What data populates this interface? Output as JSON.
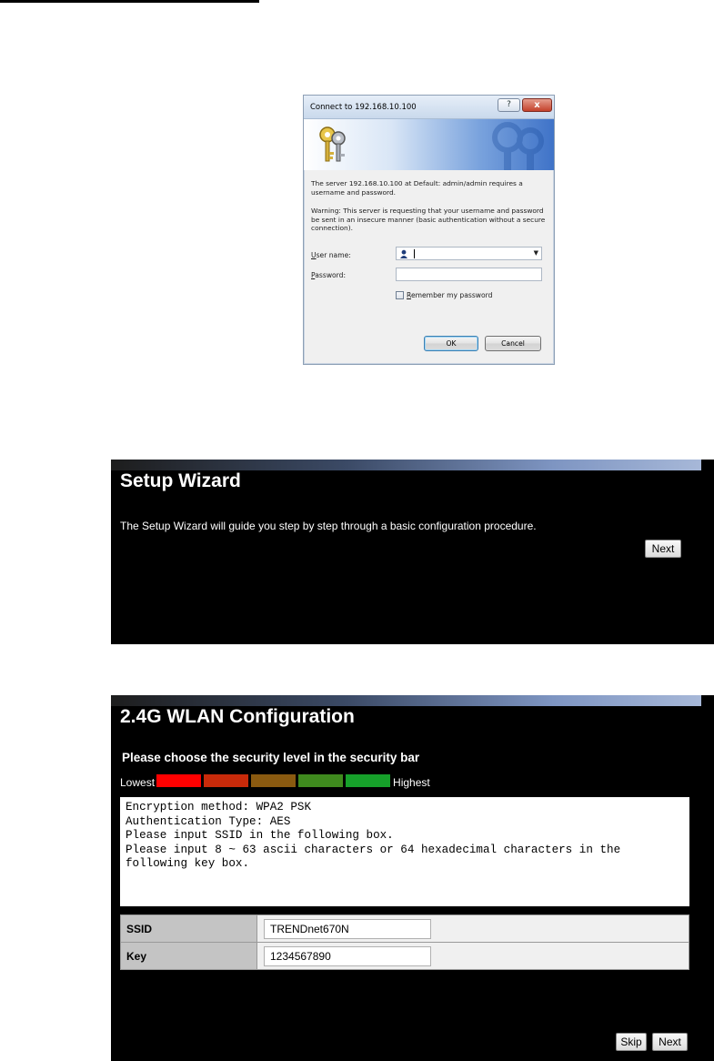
{
  "login_dialog": {
    "title": "Connect to 192.168.10.100",
    "help_glyph": "?",
    "close_glyph": "x",
    "message": "The server 192.168.10.100 at Default: admin/admin requires a username and password.",
    "warning": "Warning: This server is requesting that your username and password be sent in an insecure manner (basic authentication without a secure connection).",
    "username_label_u": "U",
    "username_label_rest": "ser name:",
    "username_value": "",
    "password_label_u": "P",
    "password_label_rest": "assword:",
    "password_value": "",
    "remember_u": "R",
    "remember_rest": "emember my password",
    "remember_checked": false,
    "ok_label": "OK",
    "cancel_label": "Cancel"
  },
  "setup_wizard": {
    "title": "Setup Wizard",
    "description": "The Setup Wizard will guide you step by step through a basic configuration procedure.",
    "next_label": "Next"
  },
  "wlan_config": {
    "title": "2.4G  WLAN Configuration",
    "subtitle": "Please choose the security level in the security bar",
    "lowest_label": "Lowest",
    "highest_label": "Highest",
    "security_levels": [
      {
        "color": "#ff0000"
      },
      {
        "color": "#c82a0a"
      },
      {
        "color": "#8a5a10"
      },
      {
        "color": "#3f8a1e"
      },
      {
        "color": "#16a02a"
      }
    ],
    "info_text": "Encryption method: WPA2 PSK\nAuthentication Type: AES\nPlease input SSID in the following box.\nPlease input 8 ~ 63 ascii characters or 64 hexadecimal characters in the\nfollowing key box.",
    "fields": [
      {
        "label": "SSID",
        "value": "TRENDnet670N"
      },
      {
        "label": "Key",
        "value": "1234567890"
      }
    ],
    "skip_label": "Skip",
    "next_label": "Next"
  }
}
